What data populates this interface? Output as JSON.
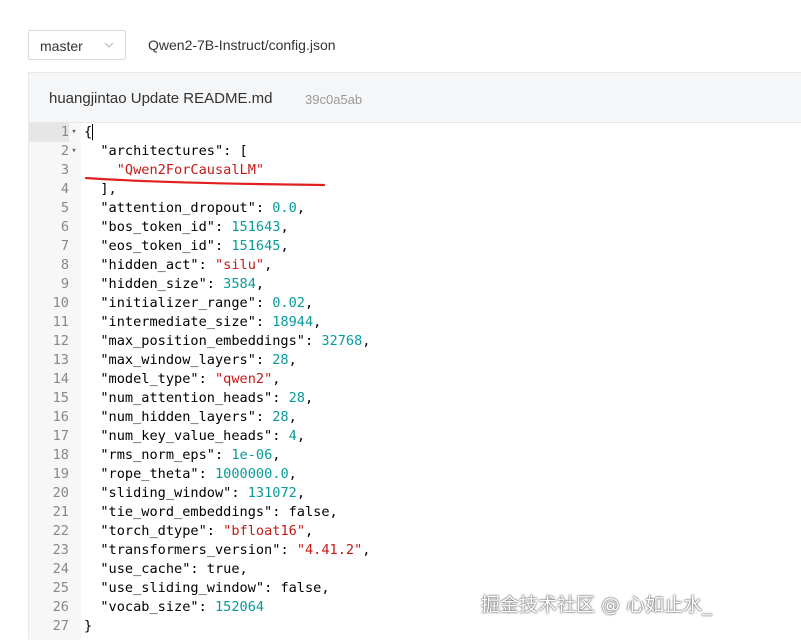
{
  "branch": {
    "label": "master",
    "icon": "chevron-down-icon"
  },
  "file_path": "Qwen2-7B-Instruct/config.json",
  "commit": {
    "message": "huangjintao Update README.md",
    "sha": "39c0a5ab"
  },
  "annotation_color": "#e02020",
  "code_lines": [
    {
      "n": "1",
      "fold": "▾"
    },
    {
      "n": "2",
      "fold": "▾"
    },
    {
      "n": "3"
    },
    {
      "n": "4"
    },
    {
      "n": "5"
    },
    {
      "n": "6"
    },
    {
      "n": "7"
    },
    {
      "n": "8"
    },
    {
      "n": "9"
    },
    {
      "n": "10"
    },
    {
      "n": "11"
    },
    {
      "n": "12"
    },
    {
      "n": "13"
    },
    {
      "n": "14"
    },
    {
      "n": "15"
    },
    {
      "n": "16"
    },
    {
      "n": "17"
    },
    {
      "n": "18"
    },
    {
      "n": "19"
    },
    {
      "n": "20"
    },
    {
      "n": "21"
    },
    {
      "n": "22"
    },
    {
      "n": "23"
    },
    {
      "n": "24"
    },
    {
      "n": "25"
    },
    {
      "n": "26"
    },
    {
      "n": "27"
    }
  ],
  "code": {
    "l1": "{",
    "l2_key": "\"architectures\"",
    "l2_rest": ": [",
    "l3_str": "\"Qwen2ForCausalLM\"",
    "l4": "],",
    "l5_key": "\"attention_dropout\"",
    "l5_val": "0.0",
    "l6_key": "\"bos_token_id\"",
    "l6_val": "151643",
    "l7_key": "\"eos_token_id\"",
    "l7_val": "151645",
    "l8_key": "\"hidden_act\"",
    "l8_val": "\"silu\"",
    "l9_key": "\"hidden_size\"",
    "l9_val": "3584",
    "l10_key": "\"initializer_range\"",
    "l10_val": "0.02",
    "l11_key": "\"intermediate_size\"",
    "l11_val": "18944",
    "l12_key": "\"max_position_embeddings\"",
    "l12_val": "32768",
    "l13_key": "\"max_window_layers\"",
    "l13_val": "28",
    "l14_key": "\"model_type\"",
    "l14_val": "\"qwen2\"",
    "l15_key": "\"num_attention_heads\"",
    "l15_val": "28",
    "l16_key": "\"num_hidden_layers\"",
    "l16_val": "28",
    "l17_key": "\"num_key_value_heads\"",
    "l17_val": "4",
    "l18_key": "\"rms_norm_eps\"",
    "l18_val": "1e-06",
    "l19_key": "\"rope_theta\"",
    "l19_val": "1000000.0",
    "l20_key": "\"sliding_window\"",
    "l20_val": "131072",
    "l21_key": "\"tie_word_embeddings\"",
    "l21_val": "false",
    "l22_key": "\"torch_dtype\"",
    "l22_val": "\"bfloat16\"",
    "l23_key": "\"transformers_version\"",
    "l23_val": "\"4.41.2\"",
    "l24_key": "\"use_cache\"",
    "l24_val": "true",
    "l25_key": "\"use_sliding_window\"",
    "l25_val": "false",
    "l26_key": "\"vocab_size\"",
    "l26_val": "152064",
    "l27": "}"
  },
  "watermark": "掘金技术社区 @ 心如止水_"
}
